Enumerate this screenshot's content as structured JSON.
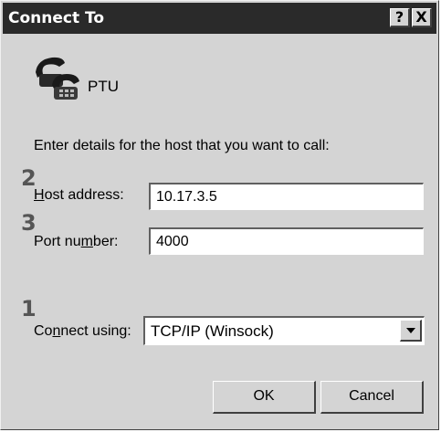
{
  "window": {
    "title": "Connect To",
    "help_button": "?",
    "close_button": "X"
  },
  "connection": {
    "icon": "telephone-connection-icon",
    "name": "PTU"
  },
  "instructions": "Enter details for the host that you want to call:",
  "host": {
    "step": "2",
    "label_pre": "",
    "label_accel": "H",
    "label_post": "ost address:",
    "value": "10.17.3.5"
  },
  "port": {
    "step": "3",
    "label_pre": "Port nu",
    "label_accel": "m",
    "label_post": "ber:",
    "value": "4000"
  },
  "connect_using": {
    "step": "1",
    "label_pre": "Co",
    "label_accel": "n",
    "label_post": "nect using:",
    "selected": "TCP/IP (Winsock)"
  },
  "buttons": {
    "ok": "OK",
    "cancel": "Cancel"
  },
  "colors": {
    "titlebar": "#2a2a2a",
    "dialog_face": "#d4d4d4",
    "field_bg": "#ffffff"
  }
}
